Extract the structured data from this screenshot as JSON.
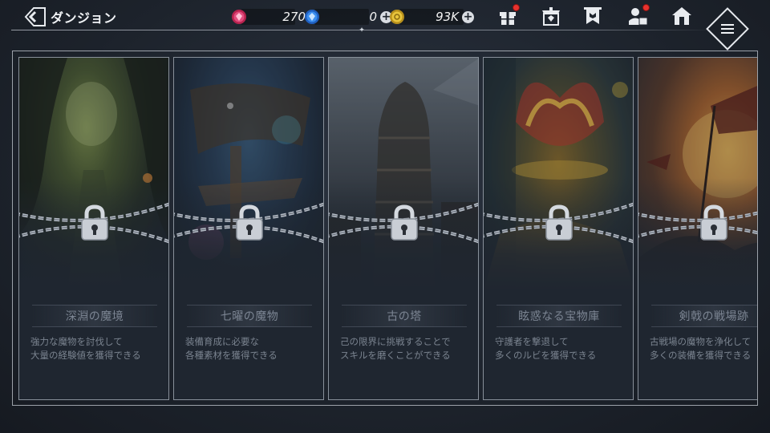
{
  "header": {
    "title": "ダンジョン",
    "back_icon": "back-arrow-icon"
  },
  "currencies": [
    {
      "name": "ruby",
      "icon": "ruby-gem-icon",
      "value": "270",
      "has_plus": false,
      "color": "#e0457a"
    },
    {
      "name": "sapphire",
      "icon": "blue-gem-icon",
      "value": "0",
      "has_plus": true,
      "color": "#3a8ff0"
    },
    {
      "name": "gold",
      "icon": "gold-coin-icon",
      "value": "93K",
      "has_plus": true,
      "color": "#e6c23a"
    }
  ],
  "nav": [
    {
      "name": "gift",
      "icon": "gift-box-icon",
      "badge": true
    },
    {
      "name": "shop",
      "icon": "shop-icon",
      "badge": false
    },
    {
      "name": "guild",
      "icon": "banner-icon",
      "badge": false
    },
    {
      "name": "profile",
      "icon": "character-icon",
      "badge": true
    },
    {
      "name": "home",
      "icon": "home-icon",
      "badge": false
    }
  ],
  "menu_icon": "hamburger-menu-icon",
  "dungeons": [
    {
      "name": "深淵の魔境",
      "desc": [
        "強力な魔物を討伐して",
        "大量の経験値を獲得できる"
      ],
      "locked": true,
      "theme": "cave"
    },
    {
      "name": "七曜の魔物",
      "desc": [
        "装備育成に必要な",
        "各種素材を獲得できる"
      ],
      "locked": true,
      "theme": "forest"
    },
    {
      "name": "古の塔",
      "desc": [
        "己の限界に挑戦することで",
        "スキルを磨くことができる"
      ],
      "locked": true,
      "theme": "tower"
    },
    {
      "name": "眩惑なる宝物庫",
      "desc": [
        "守護者を撃退して",
        "多くのルビを獲得できる"
      ],
      "locked": true,
      "theme": "treasure"
    },
    {
      "name": "剣戟の戦場跡",
      "desc": [
        "古戦場の魔物を浄化して",
        "多くの装備を獲得できる"
      ],
      "locked": true,
      "theme": "battlefield"
    }
  ],
  "lock_icon": "padlock-icon"
}
